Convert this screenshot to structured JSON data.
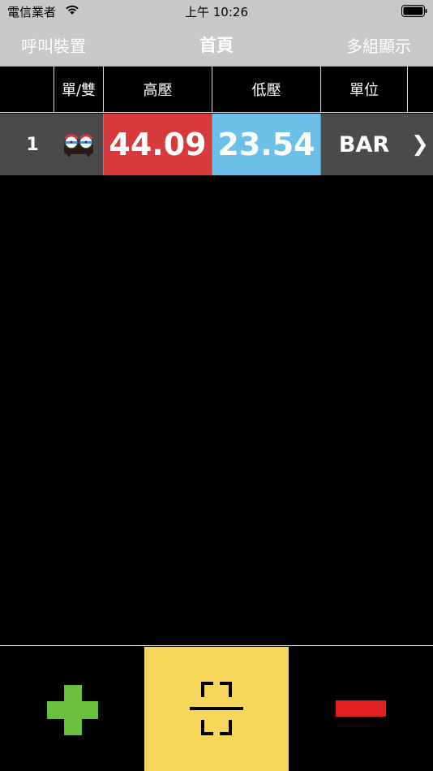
{
  "status_bar": {
    "carrier": "電信業者",
    "time": "上午 10:26"
  },
  "nav": {
    "left_label": "呼叫裝置",
    "title": "首頁",
    "right_label": "多組顯示"
  },
  "table": {
    "headers": {
      "type": "單/雙",
      "high": "高壓",
      "low": "低壓",
      "unit": "單位"
    },
    "rows": [
      {
        "index": "1",
        "type_icon": "dual-gauge-icon",
        "high": "44.09",
        "low": "23.54",
        "unit": "BAR",
        "chevron": "❯"
      }
    ]
  },
  "toolbar": {
    "add_icon": "plus-icon",
    "scan_icon": "scan-frame-icon",
    "remove_icon": "minus-icon"
  },
  "colors": {
    "high_bg": "#d63a3a",
    "low_bg": "#6cbfe9",
    "row_bg": "#4a4a4a",
    "scan_bg": "#f8d55b",
    "plus": "#6bbf3f",
    "minus": "#e02020",
    "bar_bg": "#c8c8c8"
  }
}
